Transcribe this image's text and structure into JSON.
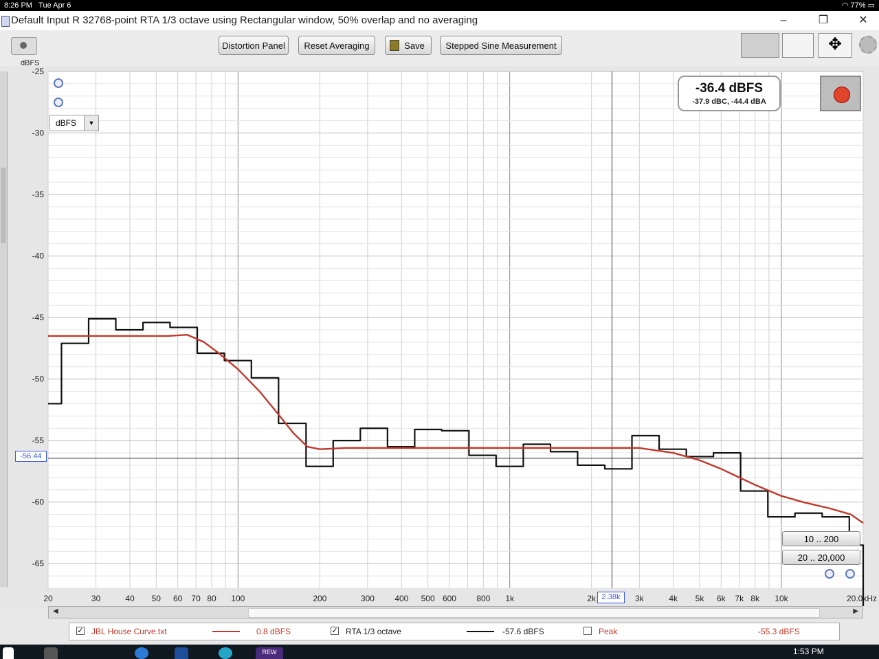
{
  "status_bar": {
    "time": "8:26 PM",
    "date": "Tue Apr 6",
    "battery": "77%"
  },
  "window": {
    "title": "Default Input R 32768-point RTA 1/3 octave using Rectangular window, 50% overlap and no averaging",
    "minimize": "–",
    "restore": "❐",
    "close": "✕"
  },
  "toolbar": {
    "distortion_label": "Distortion Panel",
    "reset_label": "Reset Averaging",
    "save_label": "Save",
    "stepped_label": "Stepped Sine Measurement"
  },
  "plot": {
    "y_unit": "dBFS",
    "unit_select": "dBFS",
    "readout_main": "-36.4 dBFS",
    "readout_sub": "-37.9 dBC, -44.4 dBA",
    "cursor_y": "-56.44",
    "cursor_x": "2.38k",
    "range_a": "10 .. 200",
    "range_b": "20 .. 20,000"
  },
  "chart_data": {
    "type": "line",
    "xscale": "log",
    "xlim": [
      20,
      20000
    ],
    "ylim": [
      -67,
      -25
    ],
    "y_ticks": [
      -25,
      -30,
      -35,
      -40,
      -45,
      -50,
      -55,
      -60,
      -65
    ],
    "x_tick_labels": [
      {
        "v": 20,
        "t": "20"
      },
      {
        "v": 30,
        "t": "30"
      },
      {
        "v": 40,
        "t": "40"
      },
      {
        "v": 50,
        "t": "50"
      },
      {
        "v": 60,
        "t": "60"
      },
      {
        "v": 70,
        "t": "70"
      },
      {
        "v": 80,
        "t": "80"
      },
      {
        "v": 100,
        "t": "100"
      },
      {
        "v": 200,
        "t": "200"
      },
      {
        "v": 300,
        "t": "300"
      },
      {
        "v": 400,
        "t": "400"
      },
      {
        "v": 500,
        "t": "500"
      },
      {
        "v": 600,
        "t": "600"
      },
      {
        "v": 800,
        "t": "800"
      },
      {
        "v": 1000,
        "t": "1k"
      },
      {
        "v": 2000,
        "t": "2k"
      },
      {
        "v": 3000,
        "t": "3k"
      },
      {
        "v": 4000,
        "t": "4k"
      },
      {
        "v": 5000,
        "t": "5k"
      },
      {
        "v": 6000,
        "t": "6k"
      },
      {
        "v": 7000,
        "t": "7k"
      },
      {
        "v": 8000,
        "t": "8k"
      },
      {
        "v": 10000,
        "t": "10k"
      },
      {
        "v": 20000,
        "t": "20.0kHz"
      }
    ],
    "cursor_x": 2380,
    "cursor_y": -56.44,
    "series": [
      {
        "name": "RTA 1/3 octave",
        "color": "#111111",
        "step": true,
        "points": [
          [
            20,
            -52.0
          ],
          [
            22.4,
            -47.1
          ],
          [
            28.2,
            -45.1
          ],
          [
            35.5,
            -46.0
          ],
          [
            44.7,
            -45.4
          ],
          [
            56.2,
            -45.8
          ],
          [
            70.8,
            -47.9
          ],
          [
            89.1,
            -48.5
          ],
          [
            112,
            -49.9
          ],
          [
            141,
            -53.6
          ],
          [
            178,
            -57.1
          ],
          [
            224,
            -55.0
          ],
          [
            282,
            -54.0
          ],
          [
            355,
            -55.5
          ],
          [
            447,
            -54.1
          ],
          [
            562,
            -54.2
          ],
          [
            708,
            -56.2
          ],
          [
            891,
            -57.1
          ],
          [
            1122,
            -55.3
          ],
          [
            1413,
            -55.9
          ],
          [
            1778,
            -57.0
          ],
          [
            2239,
            -57.3
          ],
          [
            2818,
            -54.6
          ],
          [
            3548,
            -55.7
          ],
          [
            4467,
            -56.3
          ],
          [
            5623,
            -56.0
          ],
          [
            7079,
            -59.1
          ],
          [
            8913,
            -61.2
          ],
          [
            11220,
            -60.9
          ],
          [
            14125,
            -61.2
          ],
          [
            17783,
            -63.5
          ],
          [
            20000,
            -63.5
          ]
        ]
      },
      {
        "name": "JBL House Curve.txt",
        "color": "#c0392b",
        "step": false,
        "points": [
          [
            20,
            -46.5
          ],
          [
            40,
            -46.5
          ],
          [
            55,
            -46.5
          ],
          [
            65,
            -46.4
          ],
          [
            75,
            -47.0
          ],
          [
            85,
            -47.9
          ],
          [
            100,
            -49.2
          ],
          [
            120,
            -51.0
          ],
          [
            140,
            -52.8
          ],
          [
            160,
            -54.4
          ],
          [
            180,
            -55.5
          ],
          [
            200,
            -55.7
          ],
          [
            250,
            -55.6
          ],
          [
            500,
            -55.6
          ],
          [
            1000,
            -55.6
          ],
          [
            2000,
            -55.6
          ],
          [
            3000,
            -55.6
          ],
          [
            4000,
            -56.0
          ],
          [
            5000,
            -56.6
          ],
          [
            6000,
            -57.3
          ],
          [
            7000,
            -58.0
          ],
          [
            8000,
            -58.6
          ],
          [
            10000,
            -59.5
          ],
          [
            12000,
            -60.0
          ],
          [
            15000,
            -60.5
          ],
          [
            18000,
            -61.0
          ],
          [
            20000,
            -61.7
          ]
        ]
      }
    ]
  },
  "legend": [
    {
      "name": "JBL House Curve.txt",
      "checked": true,
      "value": "0.8 dBFS",
      "color": "#c0392b"
    },
    {
      "name": "RTA 1/3 octave",
      "checked": true,
      "value": "-57.6 dBFS",
      "color": "#111111"
    },
    {
      "name": "Peak",
      "checked": false,
      "value": "-55.3 dBFS",
      "color": "#c0392b"
    }
  ],
  "taskbar": {
    "time": "1:53 PM",
    "app": "REW"
  }
}
